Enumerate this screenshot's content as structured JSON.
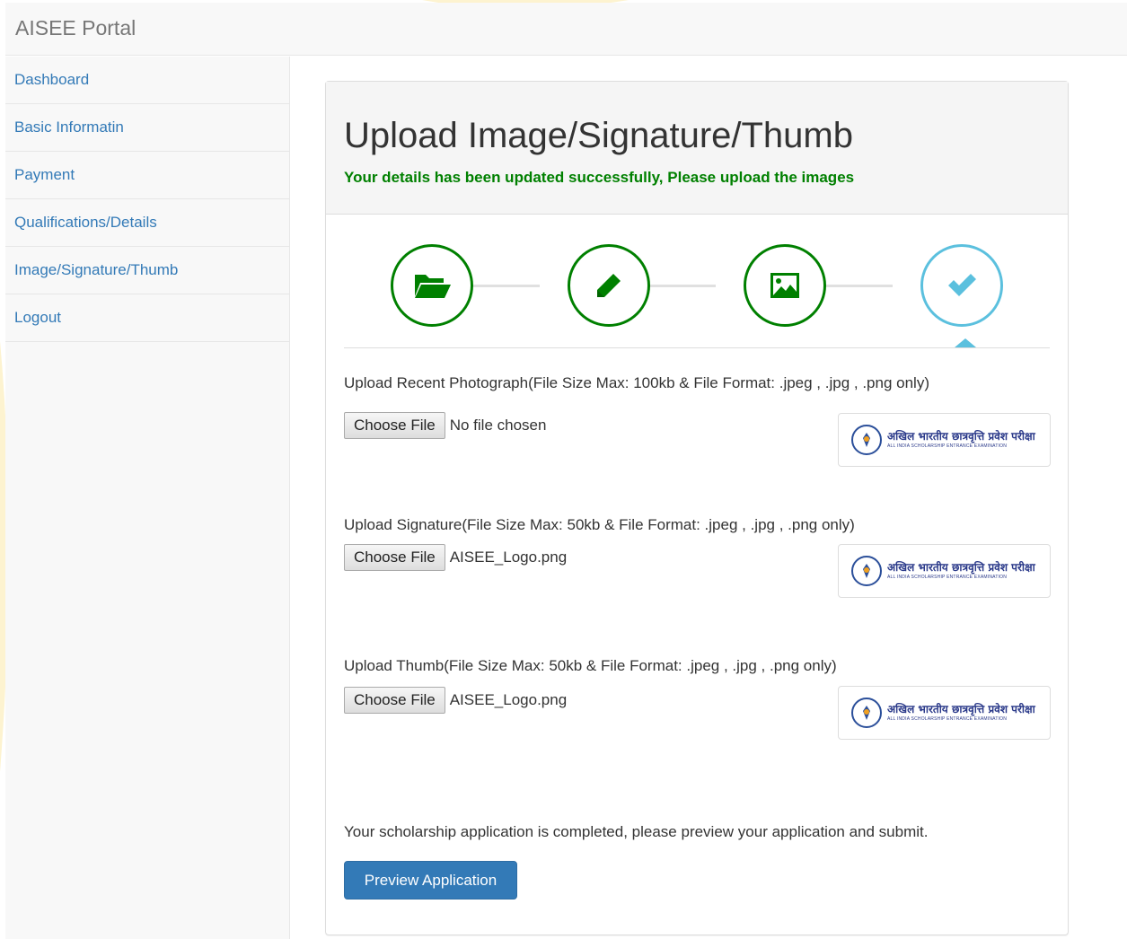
{
  "navbar": {
    "brand": "AISEE Portal"
  },
  "sidebar": {
    "items": [
      {
        "label": "Dashboard"
      },
      {
        "label": "Basic Informatin"
      },
      {
        "label": "Payment"
      },
      {
        "label": "Qualifications/Details"
      },
      {
        "label": "Image/Signature/Thumb"
      },
      {
        "label": "Logout"
      }
    ]
  },
  "panel": {
    "title": "Upload Image/Signature/Thumb",
    "success_message": "Your details has been updated successfully, Please upload the images"
  },
  "steps": [
    {
      "icon": "folder-open-icon",
      "status": "done"
    },
    {
      "icon": "pencil-icon",
      "status": "done"
    },
    {
      "icon": "image-icon",
      "status": "done"
    },
    {
      "icon": "check-icon",
      "status": "active"
    }
  ],
  "uploads": [
    {
      "label": "Upload Recent Photograph(File Size Max: 100kb & File Format: .jpeg , .jpg , .png only)",
      "button": "Choose File",
      "file_name": "No file chosen"
    },
    {
      "label": "Upload Signature(File Size Max: 50kb & File Format: .jpeg , .jpg , .png only)",
      "button": "Choose File",
      "file_name": "AISEE_Logo.png"
    },
    {
      "label": "Upload Thumb(File Size Max: 50kb & File Format: .jpeg , .jpg , .png only)",
      "button": "Choose File",
      "file_name": "AISEE_Logo.png"
    }
  ],
  "preview_logo": {
    "hindi": "अखिल भारतीय छात्रवृत्ति प्रवेश परीक्षा",
    "english": "ALL INDIA SCHOLARSHIP ENTRANCE EXAMINATION"
  },
  "completion_message": "Your scholarship application is completed, please preview your application and submit.",
  "preview_button": "Preview Application",
  "colors": {
    "link": "#337ab7",
    "success": "#008000",
    "step_done": "#008000",
    "step_active": "#5bc0de",
    "primary_button": "#337ab7"
  }
}
